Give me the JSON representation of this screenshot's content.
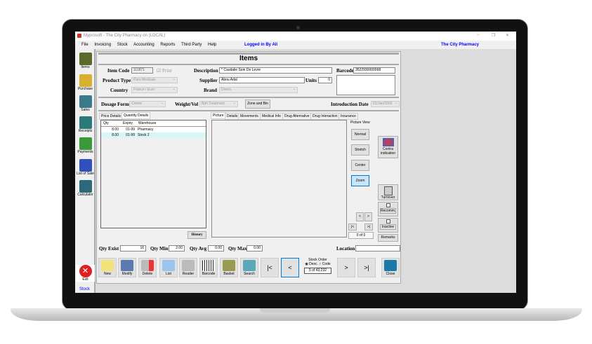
{
  "window": {
    "title": "Myprosoft - The City Pharmacy  on (LOCAL)",
    "controls": [
      "–",
      "❐",
      "✕"
    ]
  },
  "menu": {
    "items": [
      "File",
      "Invoicing",
      "Stock",
      "Accounting",
      "Reports",
      "Third Party",
      "Help"
    ],
    "logged_in": "Logged in By Ali",
    "company": "The City Pharmacy"
  },
  "sidebar": {
    "items": [
      "Items",
      "Purchase",
      "Sales",
      "Receipts",
      "Payments",
      "List of Sale",
      "Calculator"
    ],
    "exit": "Exit"
  },
  "status": "Stock",
  "form": {
    "title": "Items",
    "item_code_label": "Item Code",
    "item_code": "111871",
    "print_label": "Print",
    "description_label": "Description",
    "description": "* Caudalie Soin De Levre",
    "barcode_label": "Barcode",
    "barcode": "3522930000068",
    "product_type_label": "Product Type",
    "product_type": "Para Medicals",
    "supplier_label": "Supplier",
    "supplier": "Abou Adal",
    "units_label": "Units",
    "units": "0",
    "country_label": "Country",
    "country": "France / Euro",
    "brand_label": "Brand",
    "brand": "Divers",
    "dosage_label": "Dosage Form",
    "dosage": "Creme",
    "weight_label": "Weight/Vol",
    "weight": "Bph Treatment",
    "zone_button": "Zone and Bin",
    "intro_label": "Introduction Date",
    "intro": "01/Jan/2000"
  },
  "left_tabs": [
    "Price Details",
    "Quantity Details"
  ],
  "grid": {
    "columns": [
      "Qty",
      "Expiry",
      "Warehouse"
    ],
    "rows": [
      [
        "8.00",
        "01-99",
        "Pharmacy"
      ],
      [
        "8.00",
        "01-99",
        "Stock 2"
      ]
    ]
  },
  "history_button": "History",
  "right_tabs": [
    "Picture",
    "Details",
    "Movements",
    "Medical Info",
    "Drug Alternative",
    "Drug Interaction",
    "Insurance"
  ],
  "picture_view": {
    "label": "Picture View",
    "buttons": [
      "Normal",
      "Stretch",
      "Center",
      "Zoom"
    ],
    "counter": "0 of 0",
    "nav": [
      "<",
      ">",
      "|<",
      ">|"
    ]
  },
  "side_buttons": {
    "contra": "Contra indication",
    "turnover": "Turnover",
    "recomm": "Recomm.",
    "inactive": "Inactive",
    "remarks": "Remarks"
  },
  "qty": {
    "exist_label": "Qty Exist",
    "exist": "16",
    "min_label": "Qty Min",
    "min": "2.00",
    "avg_label": "Qty Avg",
    "avg": "0.00",
    "max_label": "Qty Max",
    "max": "0.00",
    "location_label": "Location",
    "location": ""
  },
  "toolbar": {
    "tools": [
      "New",
      "Modify",
      "Delete",
      "List",
      "Reader",
      "Barcode",
      "Basket",
      "Search"
    ],
    "first": "|<",
    "prev": "<",
    "next": ">",
    "last": ">|",
    "close": "Close"
  },
  "stock_order": {
    "label": "Stock Order",
    "desc": "Desc.",
    "code": "Code",
    "record": "5 of 43,232"
  }
}
